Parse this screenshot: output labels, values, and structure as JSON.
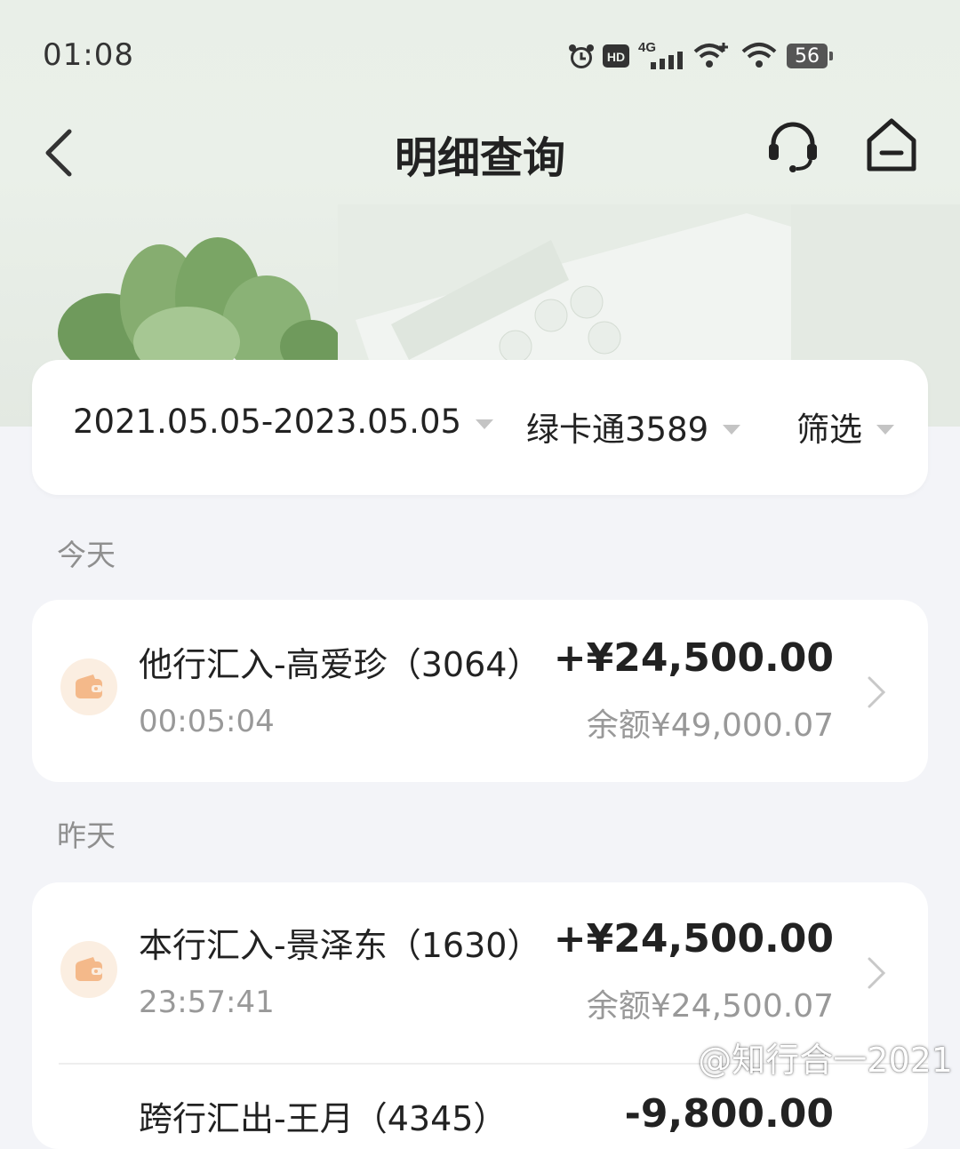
{
  "status_bar": {
    "time": "01:08",
    "battery": "56",
    "icons": [
      "alarm-icon",
      "hd-icon",
      "signal-4g-icon",
      "wifi-plus-icon",
      "wifi-icon",
      "battery-icon"
    ]
  },
  "nav": {
    "title": "明细查询",
    "back_icon": "chevron-left-icon",
    "support_icon": "headset-icon",
    "home_icon": "home-icon"
  },
  "filter": {
    "date_range": "2021.05.05-2023.05.05",
    "account": "绿卡通3589",
    "filter_label": "筛选"
  },
  "sections": [
    {
      "label": "今天",
      "transactions": [
        {
          "title": "他行汇入-高爱珍（3064）",
          "time": "00:05:04",
          "amount": "+¥24,500.00",
          "balance": "余额¥49,000.07"
        }
      ]
    },
    {
      "label": "昨天",
      "transactions": [
        {
          "title": "本行汇入-景泽东（1630）",
          "time": "23:57:41",
          "amount": "+¥24,500.00",
          "balance": "余额¥24,500.07"
        },
        {
          "title": "跨行汇出-王月（4345）",
          "amount": "-9,800.00"
        }
      ]
    }
  ],
  "watermark": "@知行合一2021",
  "colors": {
    "accent_wallet_bg": "#fbeee1",
    "accent_wallet": "#f4b98a",
    "page_bg": "#f3f4f8"
  }
}
